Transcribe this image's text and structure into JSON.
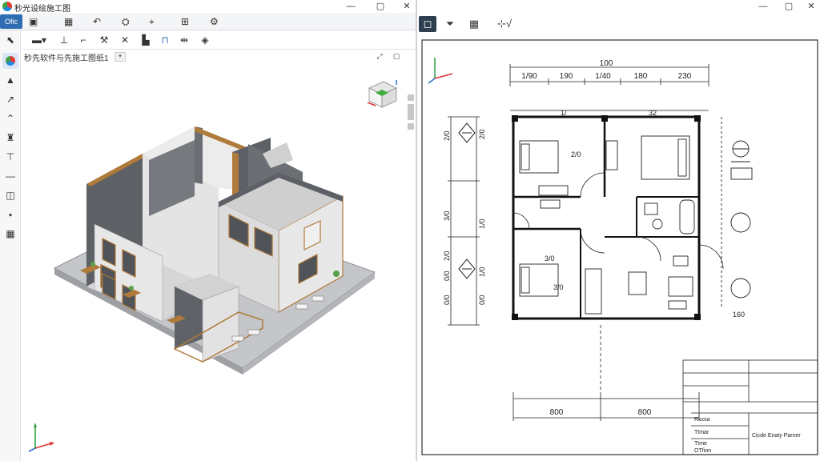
{
  "left_window": {
    "title": "秒光设绘施工图",
    "file_tab": "Ofic",
    "window_controls": {
      "minimize": "—",
      "maximize": "▢",
      "close": "✕"
    },
    "document_title": "秒先软件与先施工图纸1",
    "document_dropdown": "▾",
    "view_controls": {
      "restore": "⤢",
      "maximize": "▢"
    }
  },
  "right_window": {
    "window_controls": {
      "minimize": "—",
      "maximize": "▢",
      "close": "✕"
    }
  },
  "drawing": {
    "top_dims": [
      "1/90",
      "190",
      "1/40",
      "180",
      "230"
    ],
    "top_total": "100",
    "row2_labels": [
      "1/",
      "32"
    ],
    "left_dims": [
      "2/0",
      "3/0",
      "2/0",
      "0/0",
      "0/0"
    ],
    "left_inner_dims": [
      "2/0",
      "1/0",
      "1/0",
      "0/0"
    ],
    "bottom_dims": [
      "800",
      "800"
    ],
    "right_dims": [
      "160"
    ],
    "room_labels": [
      "2/0",
      "3/0",
      "3/0"
    ],
    "title_block_rows": [
      "Rkxxa",
      "Ttmar",
      "Ttme",
      "OTfion"
    ],
    "title_block_note": "Cicde Enaty Parner"
  },
  "colors": {
    "accent": "#2f6db3",
    "wall_dark": "#5d6065",
    "wall_light": "#e7e7e7",
    "trim": "#b07a3a",
    "floor": "#c4c6c9"
  },
  "icons": {
    "app": "app-logo-icon",
    "viewcube": "viewcube-icon"
  }
}
